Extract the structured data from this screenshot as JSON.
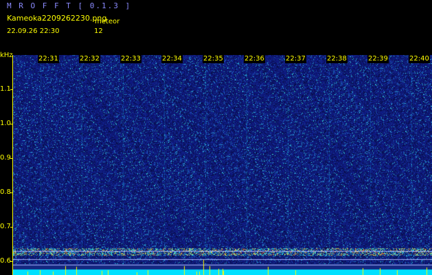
{
  "header": {
    "app_title": "M R O F F T  [ 0.1.3 ]",
    "filename": "Kameoka2209262230.png",
    "meteor_label": "meteor",
    "datetime": "22.09.26  22:30",
    "meteor_count": "12"
  },
  "spectrogram": {
    "y_unit": "kHz",
    "y_ticks": [
      "1.1",
      "1.0",
      "0.9",
      "0.8",
      "0.7",
      "0.6"
    ],
    "x_ticks": [
      "22:31",
      "22:32",
      "22:33",
      "22:34",
      "22:35",
      "22:36",
      "22:37",
      "22:38",
      "22:39",
      "22:40"
    ],
    "colors": {
      "background": "#0a1a6a",
      "axis": "#ffff00",
      "noise_floor": "#00e0ff"
    }
  }
}
